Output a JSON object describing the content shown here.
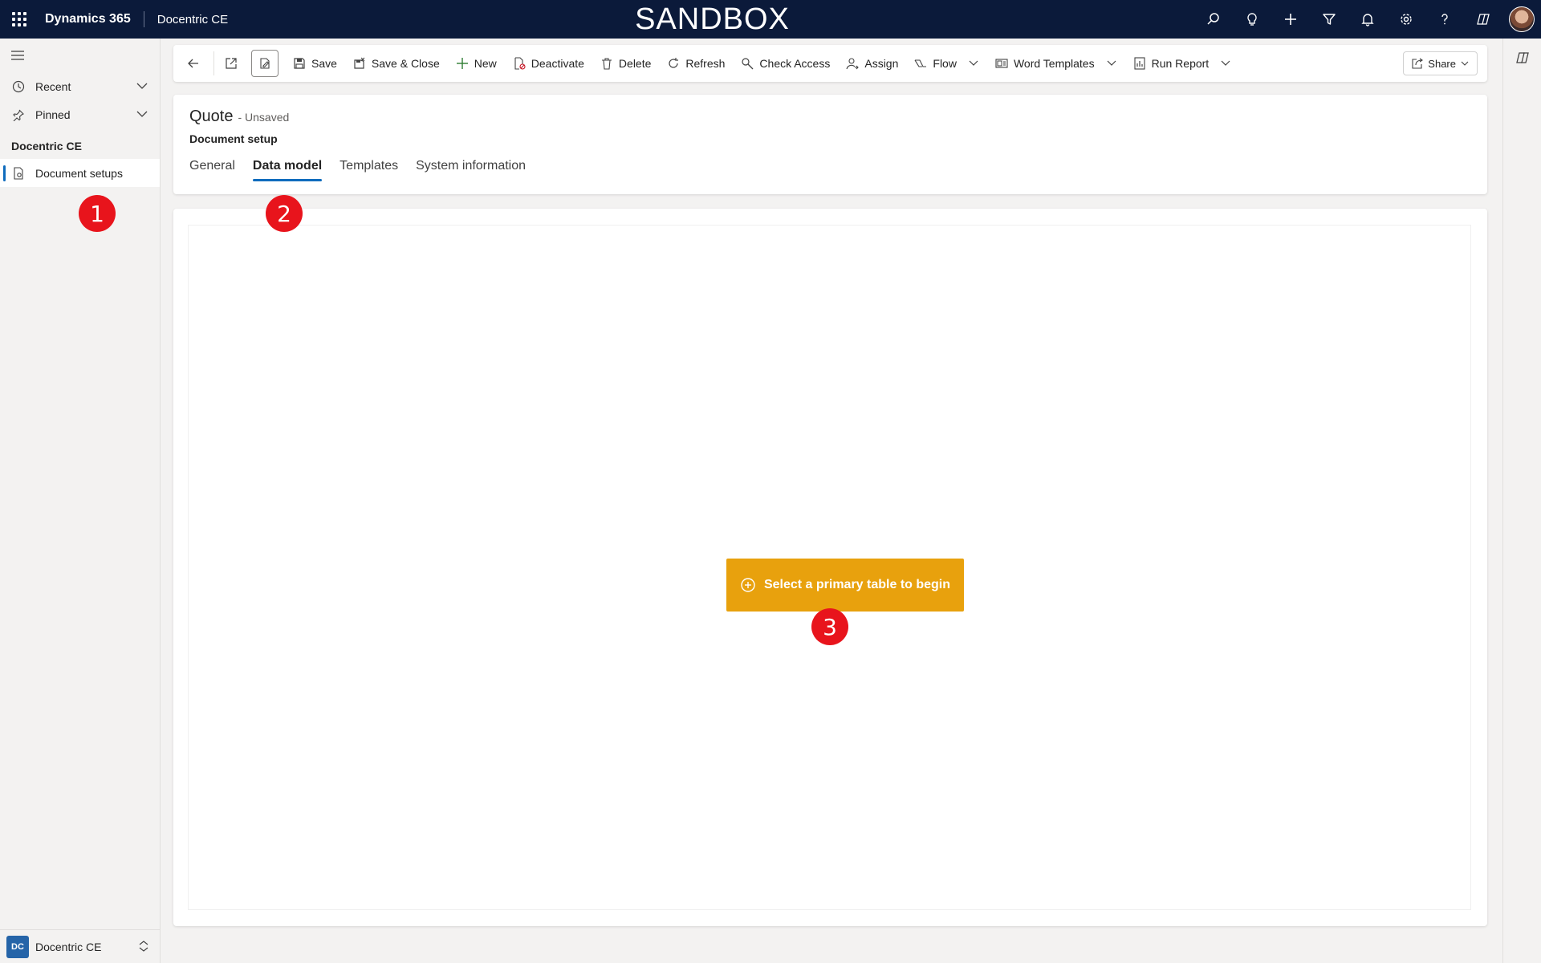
{
  "topbar": {
    "brand": "Dynamics 365",
    "app_name": "Docentric CE",
    "environment": "SANDBOX",
    "icons": [
      "search-icon",
      "lightbulb-icon",
      "plus-icon",
      "filter-icon",
      "bell-icon",
      "gear-icon",
      "help-icon",
      "copilot-icon",
      "avatar"
    ]
  },
  "sidebar": {
    "recent_label": "Recent",
    "pinned_label": "Pinned",
    "area_title": "Docentric CE",
    "items": [
      {
        "label": "Document setups",
        "selected": true
      }
    ],
    "area_switch": {
      "badge": "DC",
      "label": "Docentric CE"
    }
  },
  "commandbar": {
    "save": "Save",
    "save_close": "Save & Close",
    "new": "New",
    "deactivate": "Deactivate",
    "delete": "Delete",
    "refresh": "Refresh",
    "check_access": "Check Access",
    "assign": "Assign",
    "flow": "Flow",
    "word_templates": "Word Templates",
    "run_report": "Run Report",
    "share": "Share"
  },
  "header": {
    "title": "Quote",
    "unsaved": "- Unsaved",
    "entity": "Document setup",
    "tabs": [
      {
        "label": "General",
        "active": false
      },
      {
        "label": "Data model",
        "active": true
      },
      {
        "label": "Templates",
        "active": false
      },
      {
        "label": "System information",
        "active": false
      }
    ]
  },
  "content": {
    "begin_button": "Select a primary table to begin"
  },
  "markers": [
    "1",
    "2",
    "3"
  ],
  "colors": {
    "topbar": "#0b1a3a",
    "accent": "#0f6cbd",
    "begin_button": "#e8a10d",
    "marker": "#e8141c"
  }
}
